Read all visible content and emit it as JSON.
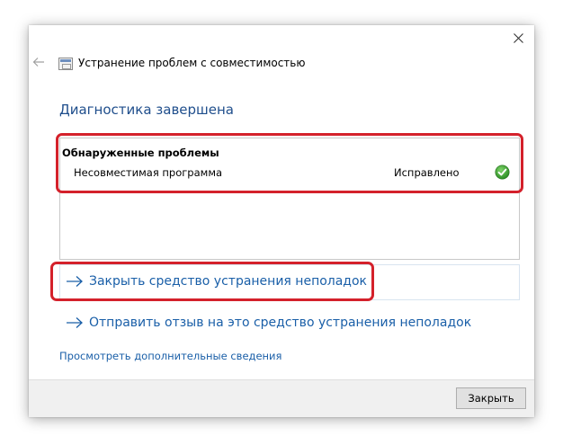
{
  "window": {
    "title": "Устранение проблем с совместимостью",
    "close_icon": "close-icon",
    "back_icon": "back-arrow-icon"
  },
  "main": {
    "heading": "Диагностика завершена",
    "results": {
      "header": "Обнаруженные проблемы",
      "items": [
        {
          "name": "Несовместимая программа",
          "status": "Исправлено",
          "status_icon": "green-check-icon"
        }
      ]
    },
    "links": {
      "close_troubleshooter": "Закрыть средство устранения неполадок",
      "send_feedback": "Отправить отзыв на это средство устранения неполадок",
      "view_details": "Просмотреть дополнительные сведения"
    }
  },
  "footer": {
    "close_button": "Закрыть"
  },
  "colors": {
    "heading": "#1f4e8c",
    "link": "#1a5fa8",
    "highlight": "#d4212b",
    "check": "#3fa535"
  }
}
